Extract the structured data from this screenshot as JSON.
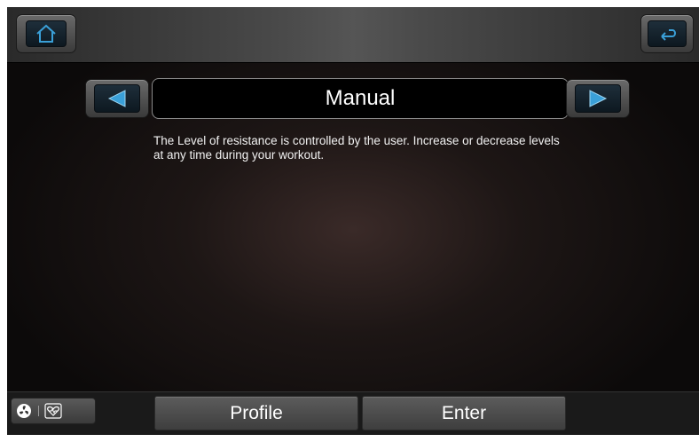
{
  "header": {
    "home_icon": "home-icon",
    "back_icon": "back-arrow-icon"
  },
  "program": {
    "title": "Manual",
    "description": "The Level of resistance is controlled by the user. Increase or decrease levels at any time during your workout.",
    "prev_icon": "triangle-left-icon",
    "next_icon": "triangle-right-icon"
  },
  "footer": {
    "fan_icon": "fan-icon",
    "heart_icon": "heart-rate-icon",
    "profile_label": "Profile",
    "enter_label": "Enter"
  },
  "colors": {
    "accent": "#3aa0d8",
    "title_border": "#8a8a8a"
  }
}
